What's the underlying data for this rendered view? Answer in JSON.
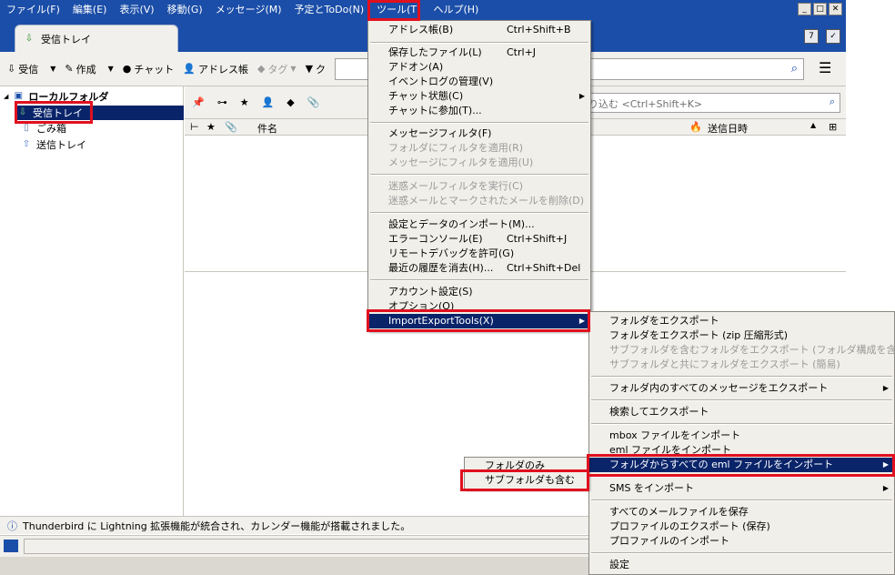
{
  "menubar": {
    "items": [
      "ファイル(F)",
      "編集(E)",
      "表示(V)",
      "移動(G)",
      "メッセージ(M)",
      "予定とToDo(N)",
      "ツール(T)",
      "ヘルプ(H)"
    ]
  },
  "tab": {
    "label": "受信トレイ"
  },
  "toolbar": {
    "get_mail": "受信",
    "write": "作成",
    "chat": "チャット",
    "address_book": "アドレス帳",
    "tag": "タグ",
    "quick_filter_prefix": "ク"
  },
  "folders": {
    "root": "ローカルフォルダ",
    "inbox": "受信トレイ",
    "trash": "ごみ箱",
    "sent": "送信トレイ"
  },
  "quick_filter": {
    "placeholder": "り込む <Ctrl+Shift+K>"
  },
  "thread_columns": {
    "subject": "件名",
    "date": "送信日時"
  },
  "status": {
    "message": "Thunderbird に Lightning 拡張機能が統合され、カレンダー機能が搭載されました。"
  },
  "tools_menu": {
    "items": [
      {
        "label": "アドレス帳(B)",
        "shortcut": "Ctrl+Shift+B"
      },
      {
        "label": "保存したファイル(L)",
        "shortcut": "Ctrl+J"
      },
      {
        "label": "アドオン(A)",
        "shortcut": ""
      },
      {
        "label": "イベントログの管理(V)",
        "shortcut": ""
      },
      {
        "label": "チャット状態(C)",
        "shortcut": ""
      },
      {
        "label": "チャットに参加(T)...",
        "shortcut": ""
      },
      {
        "label": "メッセージフィルタ(F)",
        "shortcut": ""
      },
      {
        "label": "フォルダにフィルタを適用(R)",
        "shortcut": ""
      },
      {
        "label": "メッセージにフィルタを適用(U)",
        "shortcut": ""
      },
      {
        "label": "迷惑メールフィルタを実行(C)",
        "shortcut": ""
      },
      {
        "label": "迷惑メールとマークされたメールを削除(D)",
        "shortcut": ""
      },
      {
        "label": "設定とデータのインポート(M)...",
        "shortcut": ""
      },
      {
        "label": "エラーコンソール(E)",
        "shortcut": "Ctrl+Shift+J"
      },
      {
        "label": "リモートデバッグを許可(G)",
        "shortcut": ""
      },
      {
        "label": "最近の履歴を消去(H)...",
        "shortcut": "Ctrl+Shift+Del"
      },
      {
        "label": "アカウント設定(S)",
        "shortcut": ""
      },
      {
        "label": "オプション(O)",
        "shortcut": ""
      },
      {
        "label": "ImportExportTools(X)",
        "shortcut": ""
      }
    ]
  },
  "iet_menu": {
    "items": [
      "フォルダをエクスポート",
      "フォルダをエクスポート (zip 圧縮形式)",
      "サブフォルダを含むフォルダをエクスポート (フォルダ構成を含む)",
      "サブフォルダと共にフォルダをエクスポート (簡易)",
      "フォルダ内のすべてのメッセージをエクスポート",
      "検索してエクスポート",
      "mbox ファイルをインポート",
      "eml ファイルをインポート",
      "フォルダからすべての eml ファイルをインポート",
      "SMS をインポート",
      "すべてのメールファイルを保存",
      "プロファイルのエクスポート (保存)",
      "プロファイルのインポート",
      "設定"
    ]
  },
  "eml_submenu": {
    "items": [
      "フォルダのみ",
      "サブフォルダも含む"
    ]
  },
  "colors": {
    "titlebar": "#1b4ea8",
    "selection": "#0a246a",
    "highlight_box": "#e0101e"
  }
}
